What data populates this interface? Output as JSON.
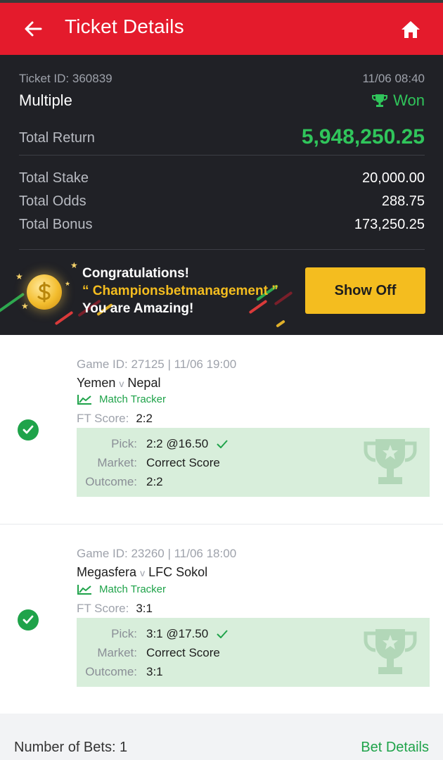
{
  "header": {
    "title": "Ticket Details"
  },
  "ticket": {
    "id_text": "Ticket ID: 360839",
    "datetime": "11/06 08:40",
    "bet_type": "Multiple",
    "status": "Won",
    "total_return_label": "Total Return",
    "total_return": "5,948,250.25",
    "rows": [
      {
        "label": "Total Stake",
        "value": "20,000.00"
      },
      {
        "label": "Total Odds",
        "value": "288.75"
      },
      {
        "label": "Total Bonus",
        "value": "173,250.25"
      }
    ]
  },
  "promo": {
    "line1": "Congratulations!",
    "line2_name": "“ Championsbetmanagement ”",
    "line3": "You are Amazing!",
    "button": "Show Off"
  },
  "bets": [
    {
      "game": "Game ID: 27125 | 11/06 19:00",
      "home": "Yemen",
      "v": "v",
      "away": "Nepal",
      "tracker": "Match Tracker",
      "ft_label": "FT Score:",
      "ft_score": "2:2",
      "pick_label": "Pick:",
      "pick": "2:2 @16.50",
      "market_label": "Market:",
      "market": "Correct Score",
      "outcome_label": "Outcome:",
      "outcome": "2:2"
    },
    {
      "game": "Game ID: 23260 | 11/06 18:00",
      "home": "Megasfera",
      "v": "v",
      "away": "LFC Sokol",
      "tracker": "Match Tracker",
      "ft_label": "FT Score:",
      "ft_score": "3:1",
      "pick_label": "Pick:",
      "pick": "3:1 @17.50",
      "market_label": "Market:",
      "market": "Correct Score",
      "outcome_label": "Outcome:",
      "outcome": "3:1"
    }
  ],
  "footer": {
    "number_of_bets": "Number of Bets: 1",
    "bet_details": "Bet Details"
  },
  "colors": {
    "brand_red": "#e41b2c",
    "win_green": "#30c55b",
    "accent_yellow": "#f4bd1f"
  }
}
